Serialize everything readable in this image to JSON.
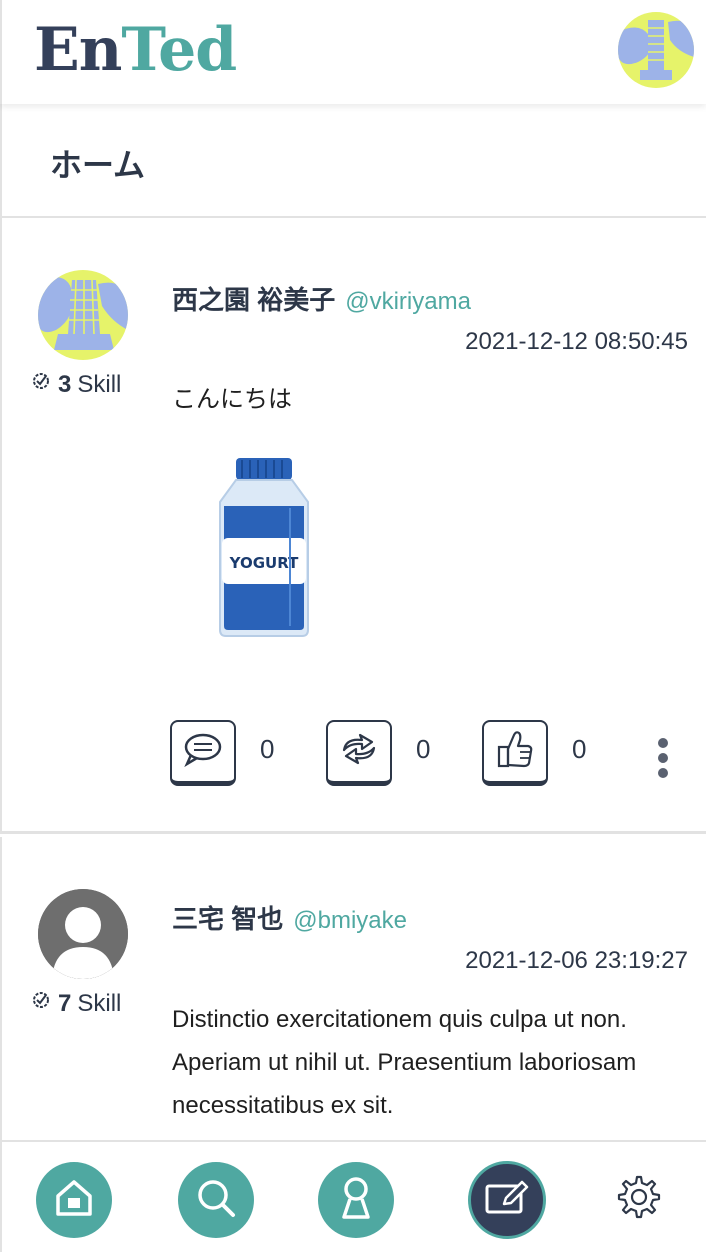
{
  "app": {
    "logo_part1": "En",
    "logo_part2": "Ted",
    "brand_color": "#4fa8a1",
    "dark_color": "#34405a"
  },
  "page": {
    "title": "ホーム"
  },
  "posts": [
    {
      "skill_count": "3",
      "skill_label": "Skill",
      "name": "西之園 裕美子",
      "handle": "@vkiriyama",
      "timestamp": "2021-12-12 08:50:45",
      "content": "こんにちは",
      "image_label": "YOGURT",
      "comment_count": "0",
      "repost_count": "0",
      "like_count": "0",
      "avatar_icon": "tower-illustration-avatar"
    },
    {
      "skill_count": "7",
      "skill_label": "Skill",
      "name": "三宅 智也",
      "handle": "@bmiyake",
      "timestamp": "2021-12-06 23:19:27",
      "content": "Distinctio exercitationem quis culpa ut non. Aperiam ut nihil ut. Praesentium laboriosam necessitatibus ex sit.",
      "avatar_icon": "default-user-avatar"
    }
  ],
  "nav": {
    "items": [
      "home-icon",
      "search-icon",
      "profile-icon",
      "compose-icon",
      "settings-icon"
    ],
    "active": "compose-icon"
  }
}
